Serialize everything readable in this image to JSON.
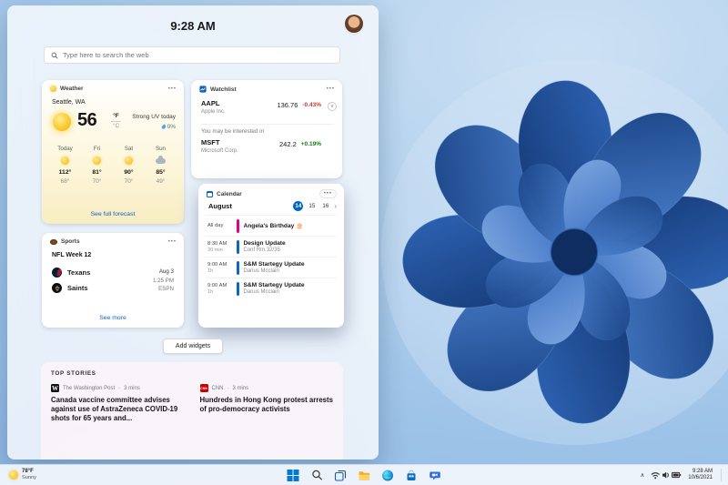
{
  "colors": {
    "accent": "#0067c0",
    "link": "#0b62c4",
    "negative": "#d13438",
    "positive": "#107c10"
  },
  "icons": {
    "more_options": "•••",
    "chevron_right": "›",
    "chevron_up": "∧",
    "stock_down": "∨"
  },
  "panel": {
    "time": "9:28 AM",
    "search": {
      "placeholder": "Type here to search the web"
    },
    "add_widgets_label": "Add widgets"
  },
  "weather": {
    "title": "Weather",
    "location": "Seattle, WA",
    "temperature": "56",
    "unit_primary": "°F",
    "unit_secondary": "°C",
    "condition": "Strong UV today",
    "precipitation": "0%",
    "forecast": [
      {
        "day": "Today",
        "high": "112°",
        "low": "68°",
        "icon": "sun"
      },
      {
        "day": "Fri",
        "high": "81°",
        "low": "70°",
        "icon": "sun"
      },
      {
        "day": "Sat",
        "high": "90°",
        "low": "70°",
        "icon": "sun"
      },
      {
        "day": "Sun",
        "high": "85°",
        "low": "49°",
        "icon": "cloud"
      }
    ],
    "see_full_forecast": "See full forecast"
  },
  "watchlist": {
    "title": "Watchlist",
    "interest_note": "You may be interested in",
    "stocks": [
      {
        "symbol": "AAPL",
        "company": "Apple Inc.",
        "price": "136.76",
        "change": "-0.43%"
      },
      {
        "symbol": "MSFT",
        "company": "Microsoft Corp.",
        "price": "242.2",
        "change": "+0.19%"
      }
    ]
  },
  "calendar": {
    "title": "Calendar",
    "month": "August",
    "dates": [
      "14",
      "15",
      "16"
    ],
    "events": [
      {
        "time": "All day",
        "duration": "",
        "title": "Angela's Birthday 🎂",
        "subtitle": "",
        "color": "#e3008c"
      },
      {
        "time": "8:30 AM",
        "duration": "30 min",
        "title": "Design Update",
        "subtitle": "Conf Rm 32/35",
        "color": "#0b66c3"
      },
      {
        "time": "9:00 AM",
        "duration": "1h",
        "title": "S&M Startegy Update",
        "subtitle": "Darius Mcclain",
        "color": "#0b66c3"
      },
      {
        "time": "9:00 AM",
        "duration": "1h",
        "title": "S&M Startegy Update",
        "subtitle": "Darius Mcclain",
        "color": "#0b66c3"
      }
    ]
  },
  "sports": {
    "title": "Sports",
    "league_week": "NFL Week 12",
    "teams": [
      {
        "name": "Texans"
      },
      {
        "name": "Saints"
      }
    ],
    "date": "Aug 3",
    "game_time": "1:25 PM",
    "network": "ESPN",
    "see_more": "See more"
  },
  "top_stories": {
    "label": "TOP STORIES",
    "separator": "·",
    "stories": [
      {
        "source": "The Washington Post",
        "source_badge": "W",
        "age": "3 mins",
        "headline": "Canada vaccine committee advises against use of AstraZeneca COVID-19 shots for 65 years and..."
      },
      {
        "source": "CNN",
        "source_badge": "CNN",
        "age": "3 mins",
        "headline": "Hundreds in Hong Kong protest arrests of pro-democracy activists"
      }
    ]
  },
  "taskbar": {
    "weather_temp": "78°F",
    "weather_condition": "Sunny",
    "clock_time": "9:28 AM",
    "clock_date": "10/6/2021"
  }
}
